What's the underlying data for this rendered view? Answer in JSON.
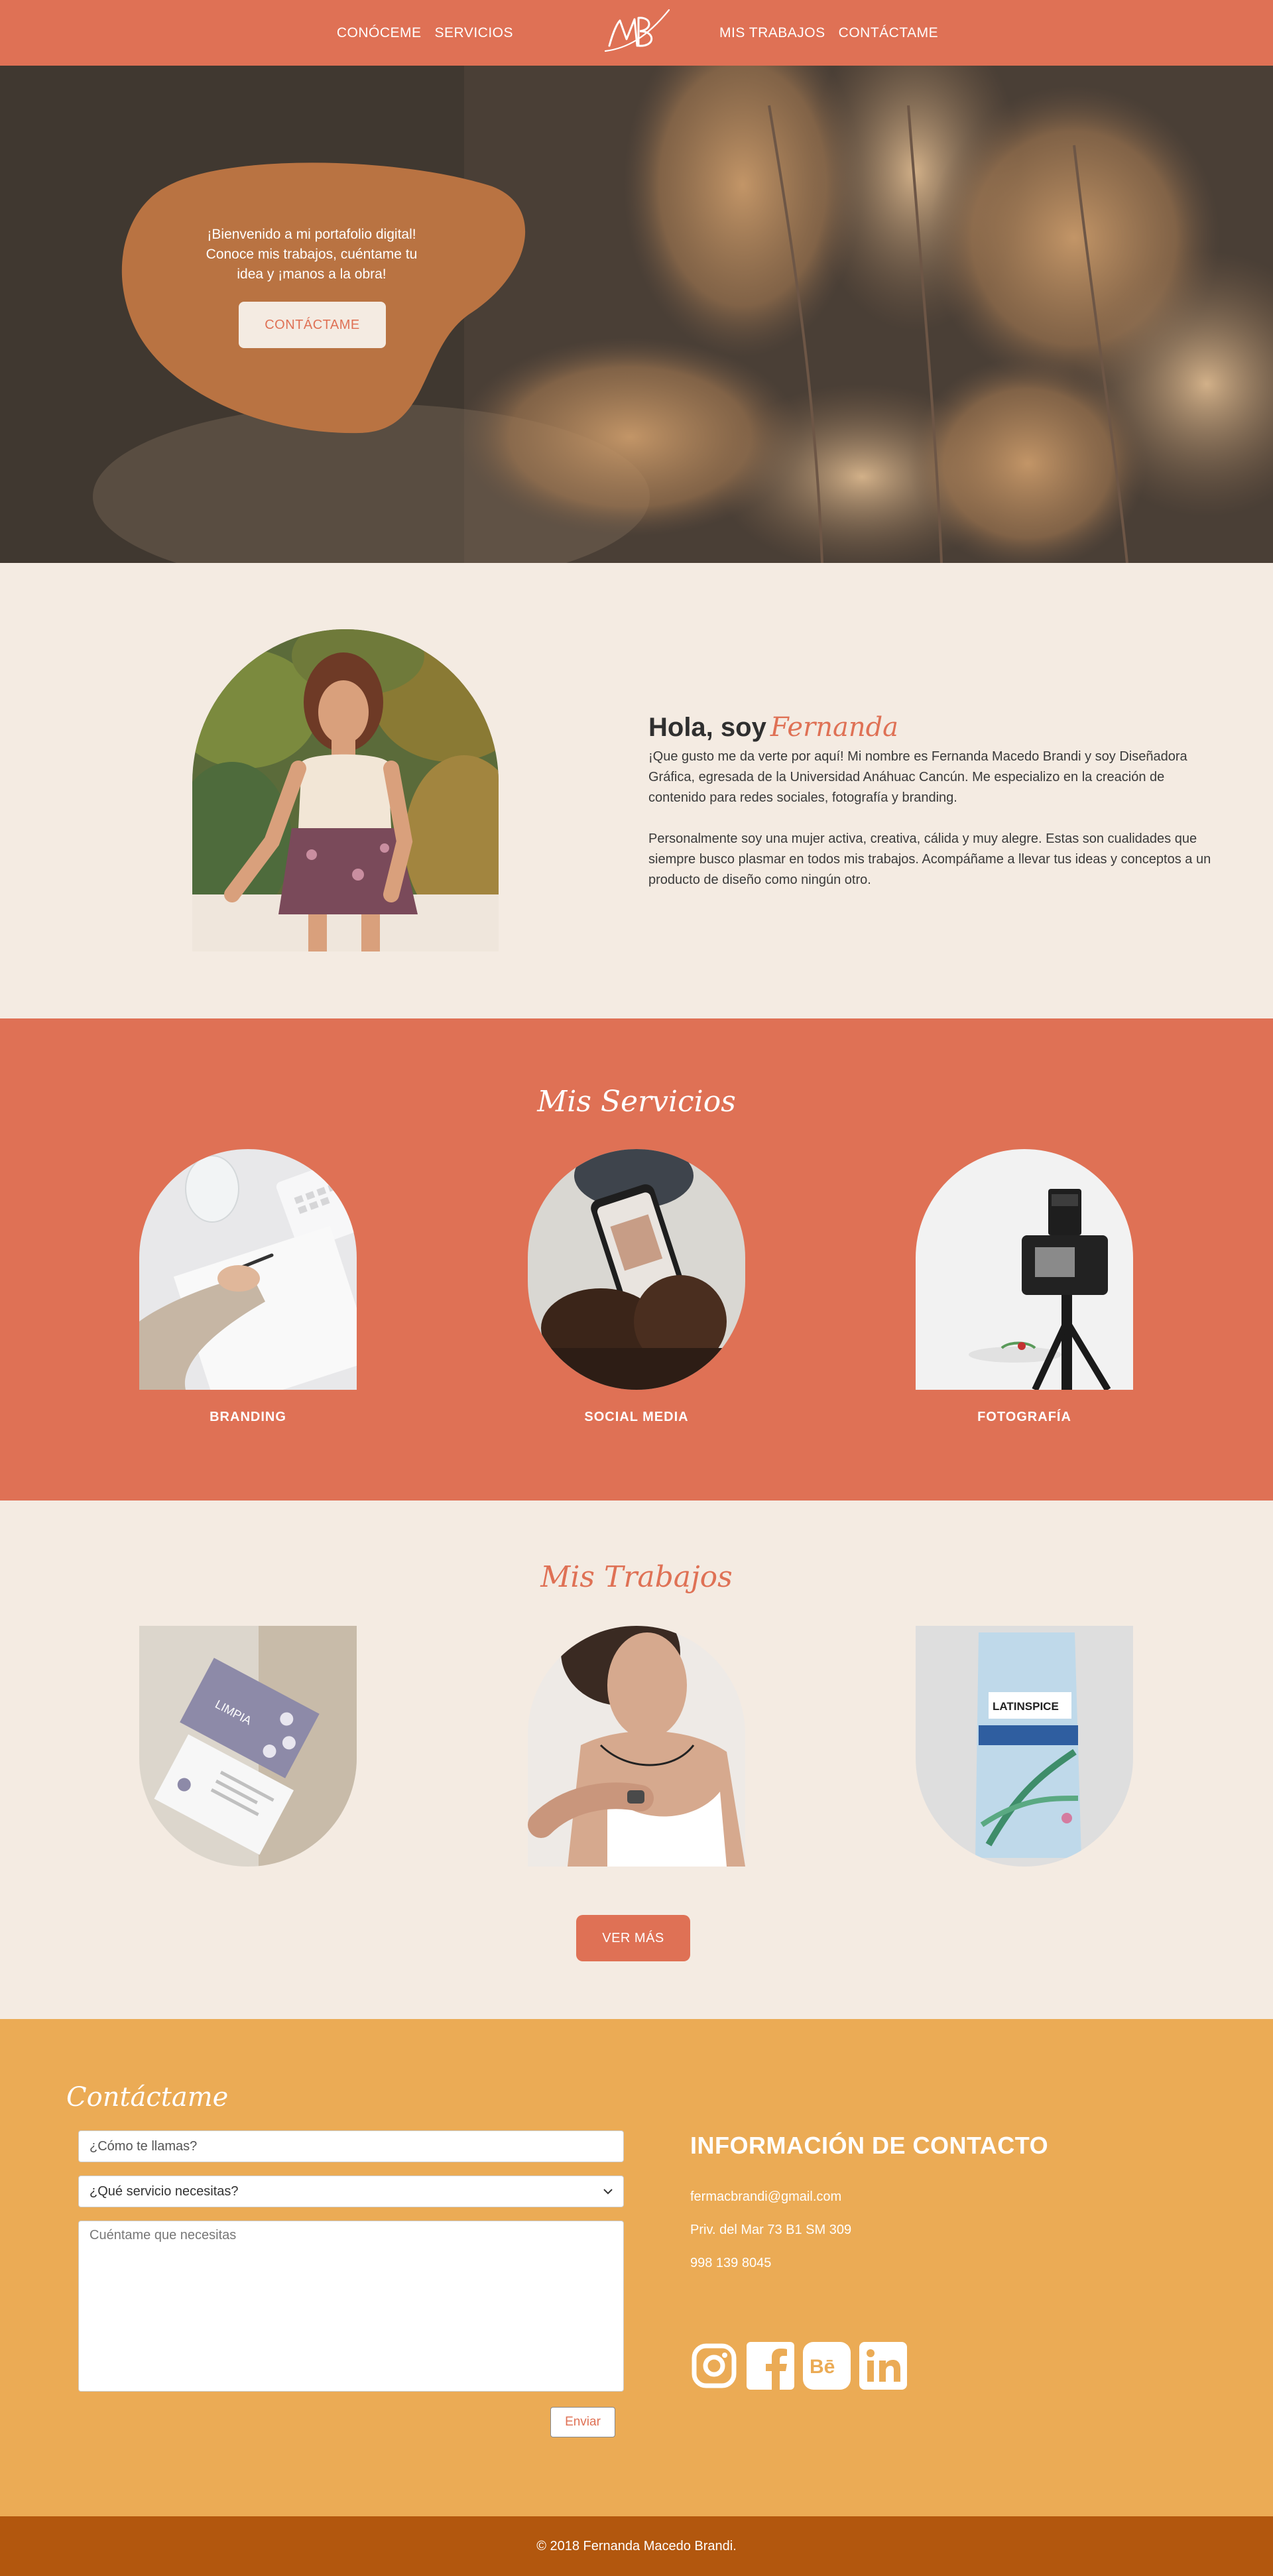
{
  "nav": {
    "items_left": [
      "CONÓCEME",
      "SERVICIOS"
    ],
    "items_right": [
      "MIS TRABAJOS",
      "CONTÁCTAME"
    ],
    "logo_text": "MB"
  },
  "hero": {
    "message": "¡Bienvenido a mi portafolio digital! Conoce mis trabajos, cuéntame tu idea y ¡manos a la obra!",
    "cta_label": "CONTÁCTAME"
  },
  "about": {
    "greeting": "Hola, soy",
    "name": "Fernanda",
    "paragraph1": "¡Que gusto me da verte por aquí! Mi nombre es Fernanda Macedo Brandi y soy Diseñadora Gráfica, egresada de la Universidad Anáhuac Cancún. Me especializo en la creación de contenido para redes sociales, fotografía y branding.",
    "paragraph2": "Personalmente soy una mujer activa, creativa, cálida y muy alegre. Estas son cualidades que siempre busco plasmar en todos mis trabajos. Acompáñame a llevar tus ideas y conceptos a un producto de diseño como ningún otro."
  },
  "services": {
    "title": "Mis Servicios",
    "items": [
      {
        "label": "BRANDING"
      },
      {
        "label": "SOCIAL MEDIA"
      },
      {
        "label": "FOTOGRAFÍA"
      }
    ]
  },
  "works": {
    "title": "Mis Trabajos",
    "button_label": "VER MÁS",
    "card_brand": "LIMPIA",
    "bag_brand": "LATINSPICE"
  },
  "contact": {
    "title": "Contáctame",
    "name_placeholder": "¿Cómo te llamas?",
    "service_selected": "¿Qué servicio necesitas?",
    "message_placeholder": "Cuéntame que necesitas",
    "send_label": "Enviar",
    "info_title": "INFORMACIÓN DE CONTACTO",
    "email": "fermacbrandi@gmail.com",
    "address": "Priv. del Mar 73 B1 SM 309",
    "phone": "998 139 8045",
    "socials": [
      "instagram-icon",
      "facebook-icon",
      "behance-icon",
      "linkedin-icon"
    ]
  },
  "footer": {
    "copyright": "© 2018 Fernanda Macedo Brandi."
  },
  "colors": {
    "coral": "#df7155",
    "cream": "#f4ebe2",
    "mustard": "#ebab55",
    "rust": "#b2570e",
    "blob": "#b97342"
  }
}
